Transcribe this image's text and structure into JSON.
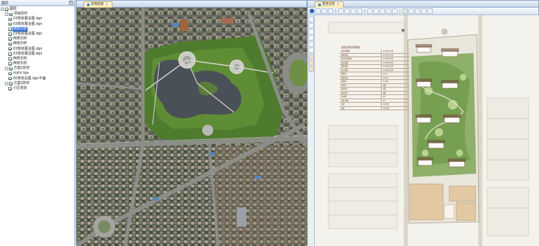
{
  "left_panel": {
    "title": "图层",
    "close_glyph": "×",
    "tree": [
      {
        "label": "图层",
        "level": 0,
        "expander": "−",
        "checked": true,
        "selected": false
      },
      {
        "label": "项目附件",
        "level": 1,
        "expander": "−",
        "checked": true,
        "selected": false
      },
      {
        "label": "03规划展业图.dgn",
        "level": 2,
        "checked": true,
        "selected": false
      },
      {
        "label": "03规划展业图.dgn",
        "level": 2,
        "checked": true,
        "selected": false
      },
      {
        "label": "西苑华府",
        "level": 2,
        "checked": true,
        "selected": true
      },
      {
        "label": "03规划展业图.dgn",
        "level": 2,
        "checked": true,
        "selected": false
      },
      {
        "label": "西苑华府",
        "level": 2,
        "checked": true,
        "selected": false
      },
      {
        "label": "西苑华府",
        "level": 2,
        "checked": true,
        "selected": false
      },
      {
        "label": "03规划展业图.dgn",
        "level": 2,
        "checked": true,
        "selected": false
      },
      {
        "label": "03规划展业图.dgn",
        "level": 2,
        "checked": true,
        "selected": false
      },
      {
        "label": "西苑华府",
        "level": 2,
        "checked": true,
        "selected": false
      },
      {
        "label": "西苑华府",
        "level": 2,
        "checked": true,
        "selected": false
      },
      {
        "label": "方案1附件",
        "level": 1,
        "expander": "−",
        "checked": true,
        "selected": false
      },
      {
        "label": "night.tga",
        "level": 2,
        "checked": true,
        "selected": false
      },
      {
        "label": "00规划总图.dgn平面",
        "level": 2,
        "checked": true,
        "selected": false
      },
      {
        "label": "方案2附件",
        "level": 1,
        "expander": "−",
        "checked": true,
        "selected": false
      },
      {
        "label": "小区规划",
        "level": 2,
        "checked": true,
        "selected": false
      }
    ]
  },
  "left_window": {
    "tab_label": "影像底图",
    "tab_close": "×"
  },
  "right_window": {
    "tab_label": "西苑华府",
    "tab_close": "×",
    "info_table": {
      "title": "总经济技术指标",
      "rows": [
        {
          "k": "总用地面积",
          "v": "0.000平方米"
        },
        {
          "k": "建筑面积",
          "v": "0.000平方米"
        },
        {
          "k": "其中住宅面积",
          "v": "0.000平方米"
        },
        {
          "k": "商业面积",
          "v": "0.000平方米"
        },
        {
          "k": "配套面积",
          "v": "0.000平方米"
        },
        {
          "k": "地下面积",
          "v": "0.000平方米"
        },
        {
          "k": "容积率",
          "v": "0.00"
        },
        {
          "k": "建筑密度",
          "v": "0.00%"
        },
        {
          "k": "绿地率",
          "v": "0.00%"
        },
        {
          "k": "停车位",
          "v": "0辆"
        },
        {
          "k": "其中地上",
          "v": "0辆"
        },
        {
          "k": "其中地下",
          "v": "0辆"
        },
        {
          "k": "总户数",
          "v": "0户"
        },
        {
          "k": "居住人数",
          "v": "0人"
        },
        {
          "k": "公建",
          "v": "0平方米"
        },
        {
          "k": "其他",
          "v": "0平方米"
        }
      ]
    }
  },
  "colors": {
    "selection": "#3875d7",
    "park_green": "#4f7b2e",
    "lake": "#4a5058",
    "plan_site": "#e9e6dc",
    "plan_green": "#8fb06a",
    "plan_commercial": "#e3c9a2"
  }
}
